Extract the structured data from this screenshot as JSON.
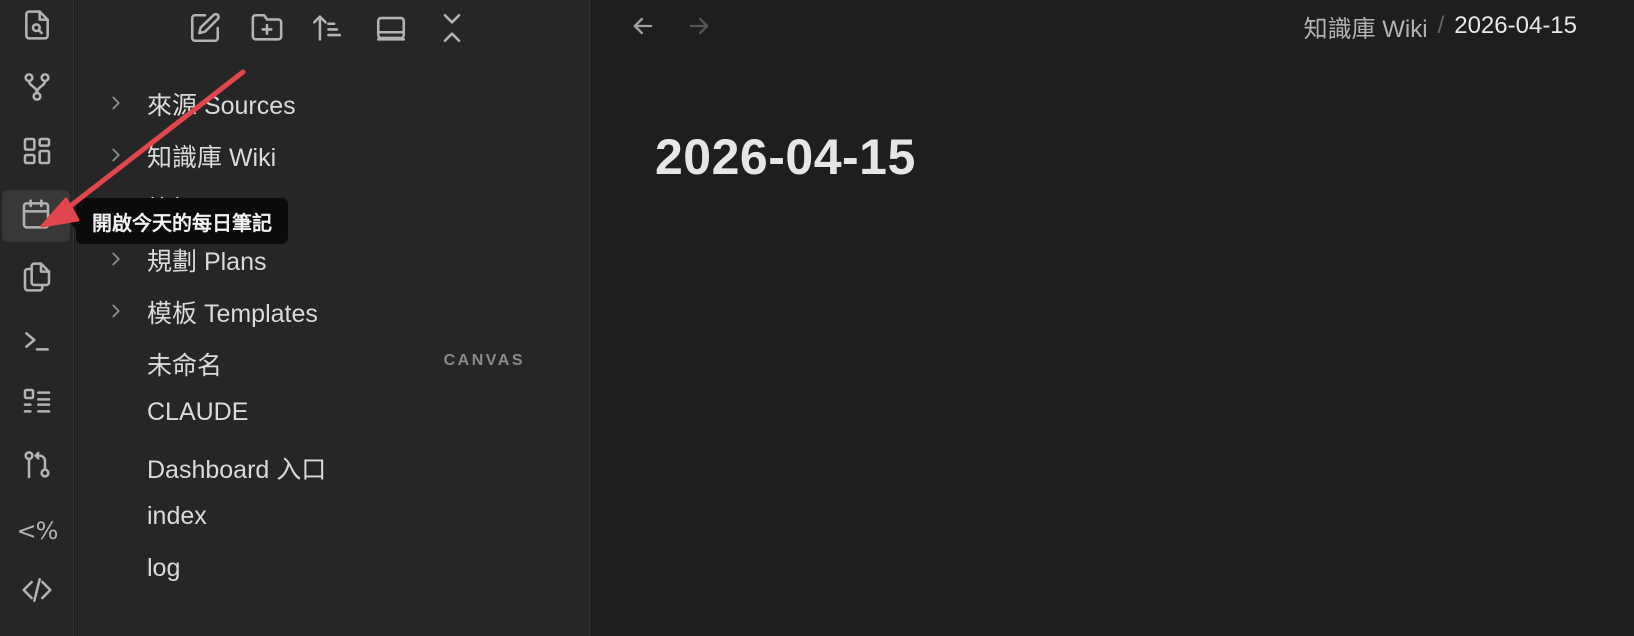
{
  "ribbon": {
    "items": [
      {
        "name": "search-icon",
        "active": false
      },
      {
        "name": "graph-view-icon",
        "active": false
      },
      {
        "name": "dashboard-icon",
        "active": false
      },
      {
        "name": "calendar-icon",
        "active": true
      },
      {
        "name": "copy-icon",
        "active": false
      },
      {
        "name": "terminal-icon",
        "active": false
      },
      {
        "name": "checklist-icon",
        "active": false
      },
      {
        "name": "git-icon",
        "active": false
      },
      {
        "name": "templater-icon",
        "text": "<%"
      },
      {
        "name": "code-icon",
        "active": false
      }
    ]
  },
  "toolbar": {
    "buttons": [
      "new-note-icon",
      "new-folder-icon",
      "sort-icon",
      "collapse-view-icon",
      "collapse-all-icon"
    ]
  },
  "tooltip": {
    "text": "開啟今天的每日筆記"
  },
  "file_tree": {
    "items": [
      {
        "label": "來源 Sources",
        "type": "folder"
      },
      {
        "label": "知識庫 Wiki",
        "type": "folder"
      },
      {
        "label": "筆記 Notes",
        "type": "folder"
      },
      {
        "label": "規劃 Plans",
        "type": "folder"
      },
      {
        "label": "模板 Templates",
        "type": "folder"
      },
      {
        "label": "未命名",
        "type": "file",
        "tag": "CANVAS"
      },
      {
        "label": "CLAUDE",
        "type": "file"
      },
      {
        "label": "Dashboard 入口",
        "type": "file"
      },
      {
        "label": "index",
        "type": "file"
      },
      {
        "label": "log",
        "type": "file"
      }
    ]
  },
  "header": {
    "breadcrumb_parent": "知識庫 Wiki",
    "breadcrumb_sep": "/",
    "breadcrumb_current": "2026-04-15"
  },
  "document": {
    "title": "2026-04-15"
  },
  "colors": {
    "accent_arrow": "#e0464b",
    "background": "#1e1e1e",
    "sidebar": "#262626"
  }
}
